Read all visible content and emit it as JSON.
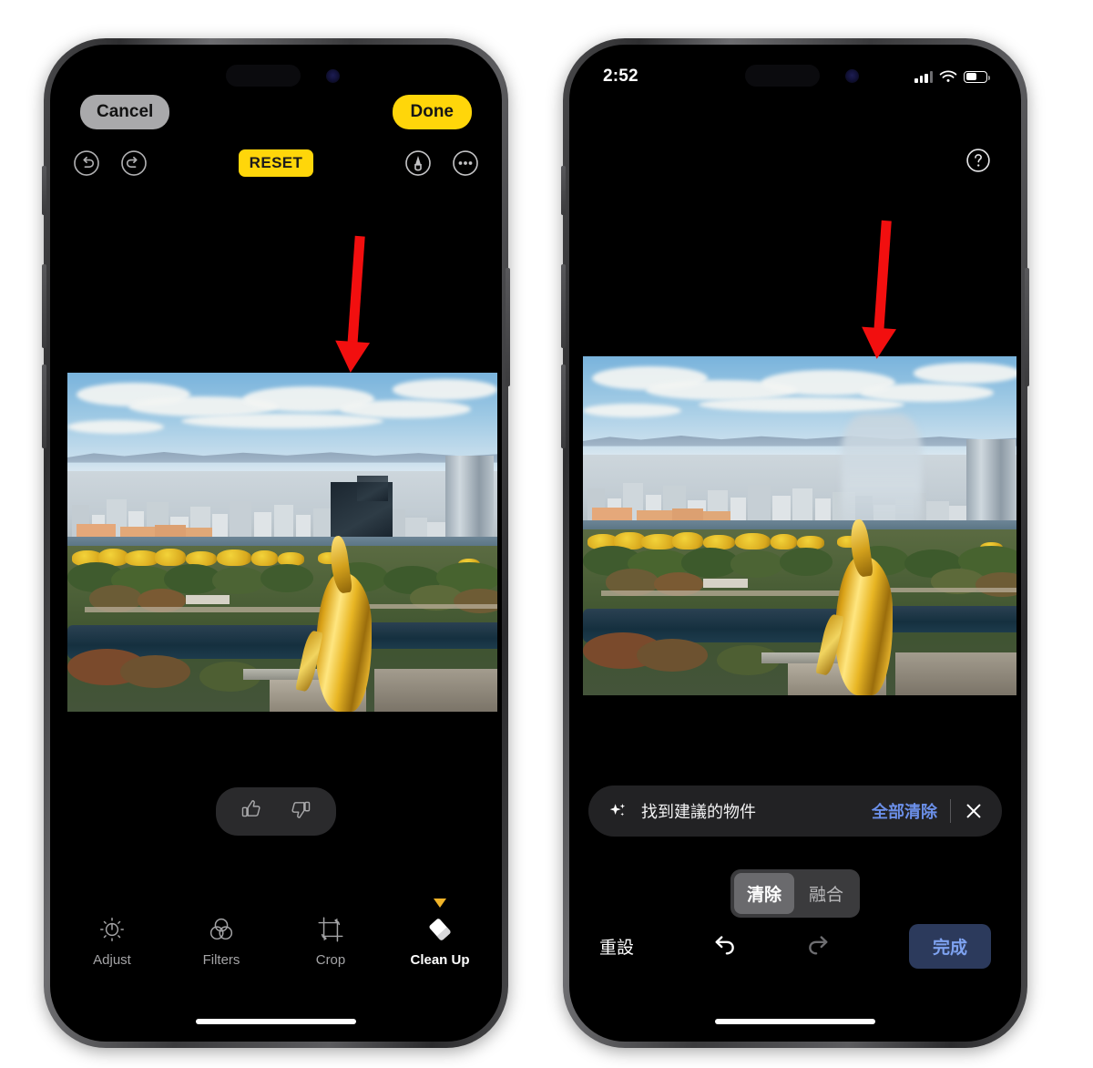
{
  "left_phone": {
    "top": {
      "cancel_label": "Cancel",
      "done_label": "Done",
      "reset_label": "RESET",
      "undo_icon": "undo-icon",
      "redo_icon": "redo-icon",
      "markup_icon": "markup-pen-icon",
      "more_icon": "more-ellipsis-icon"
    },
    "feedback": {
      "thumbs_up_icon": "thumbs-up-icon",
      "thumbs_down_icon": "thumbs-down-icon"
    },
    "edit_tabs": [
      {
        "label": "Adjust",
        "icon": "adjust-dial-icon",
        "active": false,
        "badge": false
      },
      {
        "label": "Filters",
        "icon": "filters-circles-icon",
        "active": false,
        "badge": false
      },
      {
        "label": "Crop",
        "icon": "crop-rotate-icon",
        "active": false,
        "badge": false
      },
      {
        "label": "Clean Up",
        "icon": "eraser-icon",
        "active": true,
        "badge": true
      }
    ]
  },
  "right_phone": {
    "status": {
      "time": "2:52",
      "cellular_icon": "cellular-bars-icon",
      "wifi_icon": "wifi-icon",
      "battery_icon": "battery-icon"
    },
    "help_icon": "question-mark-circle-icon",
    "suggestion": {
      "sparkle_icon": "sparkle-icon",
      "message": "找到建議的物件",
      "clear_all_label": "全部清除",
      "close_icon": "close-x-icon"
    },
    "segmented": {
      "options": [
        {
          "label": "清除",
          "selected": true
        },
        {
          "label": "融合",
          "selected": false
        }
      ]
    },
    "bottom": {
      "reset_label": "重設",
      "undo_icon": "undo-arrow-icon",
      "redo_icon": "redo-arrow-icon",
      "done_label": "完成"
    }
  },
  "annotations": {
    "arrow_left": {
      "icon": "red-down-arrow",
      "color": "#f20f0f"
    },
    "arrow_right": {
      "icon": "red-down-arrow",
      "color": "#f20f0f"
    }
  },
  "photo": {
    "description": "Aerial view of Osaka city skyline with Osaka Castle park, autumn ginkgo trees, moat and golden shachihoko ornament in foreground"
  },
  "colors": {
    "accent_yellow": "#ffd60a",
    "accent_blue": "#6b8fe8",
    "arrow_red": "#f20f0f",
    "done_bg_blue": "#2c3a5c"
  }
}
